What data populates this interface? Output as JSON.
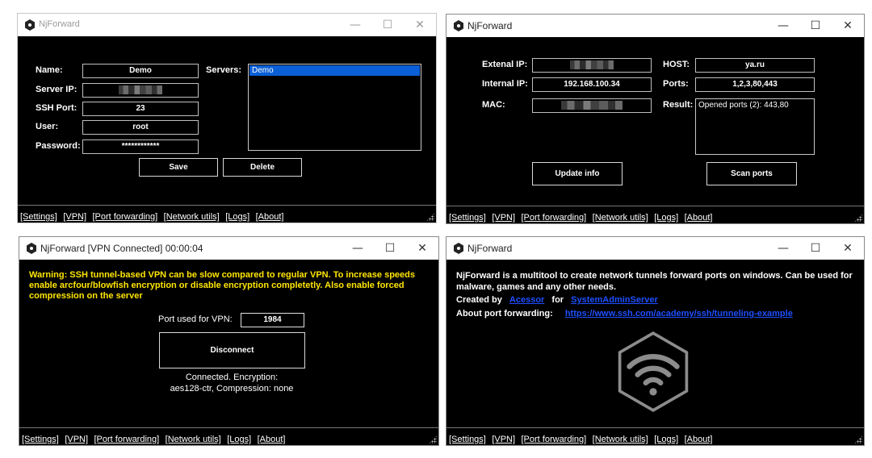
{
  "app": {
    "name": "NjForward"
  },
  "footer_links": [
    "[Settings]",
    "[VPN]",
    "[Port forwarding]",
    "[Network utils]",
    "[Logs]",
    "[About]"
  ],
  "window_buttons": {
    "minimize": "—",
    "maximize": "☐",
    "close": "✕"
  },
  "settings": {
    "title": "NjForward",
    "name_label": "Name:",
    "name_value": "Demo",
    "server_ip_label": "Server IP:",
    "ssh_port_label": "SSH Port:",
    "ssh_port_value": "23",
    "user_label": "User:",
    "user_value": "root",
    "password_label": "Password:",
    "password_value": "************",
    "servers_label": "Servers:",
    "servers": [
      "Demo"
    ],
    "save_label": "Save",
    "delete_label": "Delete"
  },
  "network": {
    "title": "NjForward",
    "external_ip_label": "Extenal IP:",
    "internal_ip_label": "Internal IP:",
    "internal_ip_value": "192.168.100.34",
    "mac_label": "MAC:",
    "host_label": "HOST:",
    "host_value": "ya.ru",
    "ports_label": "Ports:",
    "ports_value": "1,2,3,80,443",
    "result_label": "Result:",
    "result_value": "Opened ports (2): 443,80",
    "update_label": "Update info",
    "scan_label": "Scan ports"
  },
  "vpn": {
    "title": "NjForward [VPN Connected] 00:00:04",
    "warning": "Warning: SSH tunnel-based VPN can be slow compared to regular VPN. To increase speeds enable arcfour/blowfish encryption or disable encryption completetly. Also enable forced compression on the server",
    "port_label": "Port used for VPN:",
    "port_value": "1984",
    "disconnect_label": "Disconnect",
    "status_line1": "Connected. Encryption:",
    "status_line2": "aes128-ctr, Compression: none"
  },
  "about": {
    "title": "NjForward",
    "description": "NjForward is a multitool to create network tunnels  forward ports on windows. Can be used for malware, games and any other needs.",
    "created_by_label": "Created by",
    "author1": "Acessor",
    "for_label": "for",
    "author2": "SystemAdminServer",
    "about_pf_label": "About port forwarding:",
    "pf_link": "https://www.ssh.com/academy/ssh/tunneling-example"
  }
}
